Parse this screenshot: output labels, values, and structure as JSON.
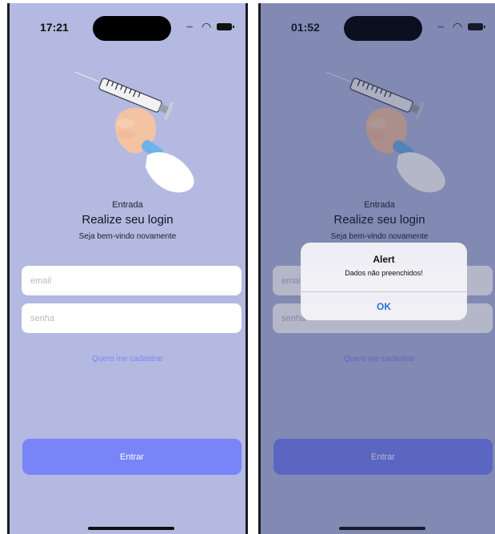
{
  "left_phone": {
    "status": {
      "time": "17:21"
    },
    "section_label": "Entrada",
    "title": "Realize seu login",
    "subtitle": "Seja bem-vindo novamente",
    "email_placeholder": "email",
    "password_placeholder": "senha",
    "register_link": "Quero me cadastrar",
    "login_button": "Entrar"
  },
  "right_phone": {
    "status": {
      "time": "01:52"
    },
    "section_label": "Entrada",
    "title": "Realize seu login",
    "subtitle": "Seja bem-vindo novamente",
    "email_placeholder": "email",
    "password_placeholder": "senha",
    "register_link": "Quero me cadastrar",
    "login_button": "Entrar",
    "alert": {
      "title": "Alert",
      "message": "Dados não preenchidos!",
      "ok_label": "OK"
    }
  },
  "colors": {
    "background": "#b3b9e0",
    "button": "#7884f7",
    "link": "#7b86f2",
    "alert_ok": "#2f6fe0"
  },
  "icons": [
    "wifi-icon",
    "battery-icon",
    "signal-icon",
    "syringe-hand-illustration"
  ]
}
